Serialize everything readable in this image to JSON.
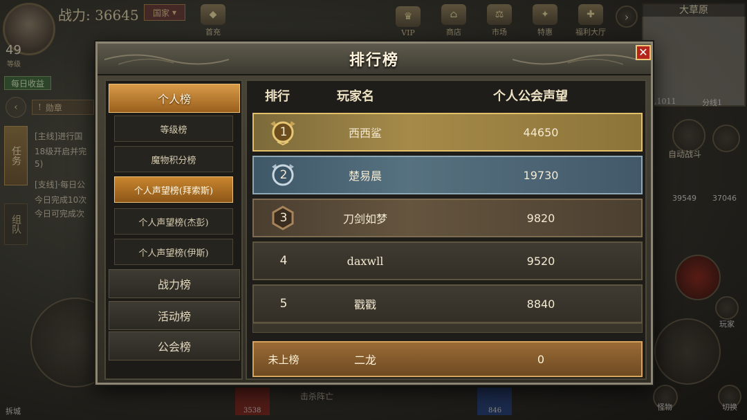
{
  "hud": {
    "power_label": "战力: 36645",
    "nation_button": "国家",
    "level": "49",
    "level_label": "等级",
    "top_icons": [
      "首充",
      "VIP",
      "商店",
      "市场",
      "特惠",
      "福利大厅"
    ],
    "minimap_title": "大草原",
    "minimap_coords": "73,1011",
    "minimap_line": "分线1",
    "daily_income": "每日收益",
    "medal_label": "勋章",
    "task_tab": "任务",
    "team_tab": "组队",
    "quests": [
      "[主线]进行国",
      "18级开启并完",
      "5)",
      "[支线]·每日公",
      "今日完成10次",
      "今日可完成次"
    ],
    "auto_battle": "自动战斗",
    "resource_left": "39549",
    "resource_right": "37046",
    "player_label": "玩家",
    "switch_label": "切换",
    "kill_label": "击杀阵亡",
    "bottom_left_value": "3538",
    "bottom_right_value": "846",
    "settings_label": "怪物",
    "build_label": "拆城"
  },
  "dialog": {
    "title": "排行榜",
    "close_symbol": "✕",
    "sidebar": {
      "main_items": [
        "个人榜",
        "战力榜",
        "活动榜",
        "公会榜"
      ],
      "sub_items": [
        "等级榜",
        "魔物积分榜",
        "个人声望榜(拜索斯)",
        "个人声望榜(杰彭)",
        "个人声望榜(伊斯)"
      ],
      "active_main": "个人榜",
      "active_sub": "个人声望榜(拜索斯)"
    },
    "table": {
      "headers": [
        "排行",
        "玩家名",
        "个人公会声望"
      ],
      "rows": [
        {
          "rank": "1",
          "name": "西西鲨",
          "score": "44650"
        },
        {
          "rank": "2",
          "name": "楚易晨",
          "score": "19730"
        },
        {
          "rank": "3",
          "name": "刀剑如梦",
          "score": "9820"
        },
        {
          "rank": "4",
          "name": "daxwll",
          "score": "9520"
        },
        {
          "rank": "5",
          "name": "戳戳",
          "score": "8840"
        }
      ],
      "self_row": {
        "rank": "未上榜",
        "name": "二龙",
        "score": "0"
      }
    }
  },
  "colors": {
    "gold_medal": "#d9b25a",
    "silver_medal": "#b9c9d3",
    "bronze_medal": "#9a7a52",
    "active_tab": "#c8862e",
    "close_red": "#b4261c"
  }
}
